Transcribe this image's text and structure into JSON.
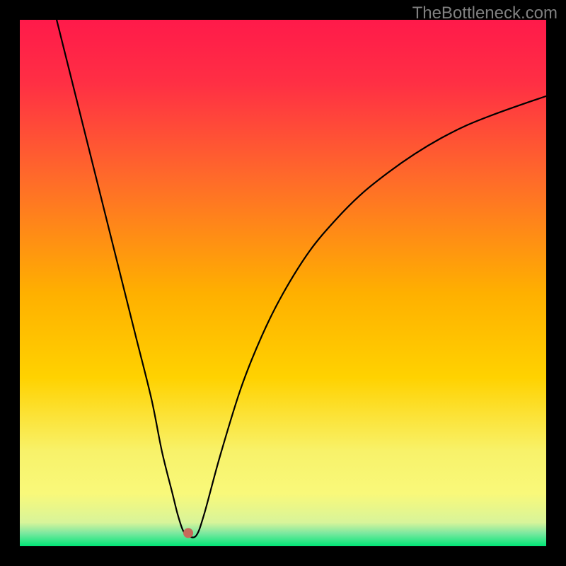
{
  "watermark": "TheBottleneck.com",
  "chart_data": {
    "type": "line",
    "title": "",
    "xlabel": "",
    "ylabel": "",
    "xlim": [
      0,
      100
    ],
    "ylim": [
      0,
      100
    ],
    "grid": false,
    "background_gradient": {
      "top": "#ff1a4a",
      "upper_mid": "#ff6a2a",
      "mid": "#ffd200",
      "lower_mid": "#f9f97a",
      "bottom": "#00e676"
    },
    "series": [
      {
        "name": "bottleneck-curve",
        "color": "#000000",
        "x": [
          7,
          10,
          13,
          16,
          19,
          22,
          25,
          27,
          29,
          30,
          31,
          32,
          33.5,
          35,
          38,
          42,
          46,
          50,
          55,
          60,
          65,
          70,
          75,
          80,
          85,
          90,
          95,
          100
        ],
        "y": [
          100,
          88,
          76,
          64,
          52,
          40,
          28,
          18,
          10,
          6,
          3,
          2,
          2,
          6,
          17,
          30,
          40,
          48,
          56,
          62,
          67,
          71,
          74.5,
          77.5,
          80,
          82,
          83.8,
          85.5
        ]
      }
    ],
    "marker": {
      "name": "optimal-point",
      "x": 32,
      "y": 2.5,
      "color": "#c76a5a",
      "radius": 7
    }
  }
}
